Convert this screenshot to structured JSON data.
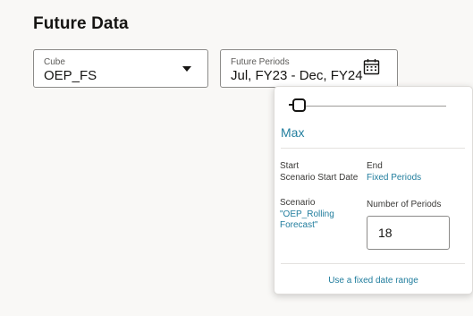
{
  "page": {
    "title": "Future Data"
  },
  "cube": {
    "label": "Cube",
    "value": "OEP_FS"
  },
  "future_periods": {
    "label": "Future Periods",
    "value": "Jul, FY23 - Dec, FY24"
  },
  "popup": {
    "slider_label": "Max",
    "start_heading": "Start",
    "start_value": "Scenario Start Date",
    "end_heading": "End",
    "end_value": "Fixed Periods",
    "scenario_heading": "Scenario",
    "scenario_value_line1": "\"OEP_Rolling",
    "scenario_value_line2": "Forecast\"",
    "num_periods_label": "Number of Periods",
    "num_periods_value": "18",
    "fixed_range_link": "Use a fixed date range"
  },
  "icons": {
    "dropdown": "chevron-down-icon",
    "calendar": "calendar-icon"
  },
  "colors": {
    "link": "#227e9e",
    "text": "#161513",
    "background": "#f9f8f6"
  }
}
